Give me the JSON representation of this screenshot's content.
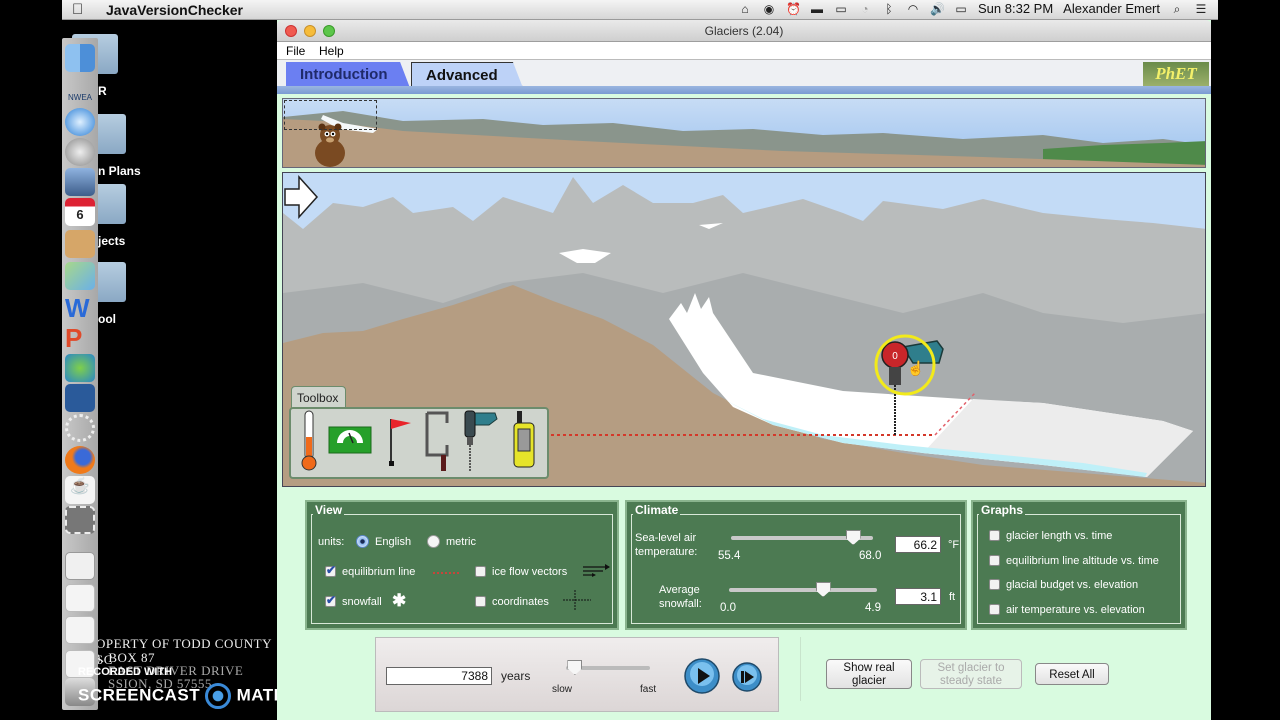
{
  "os": {
    "app_name": "JavaVersionChecker",
    "clock": "Sun 8:32 PM",
    "user": "Alexander Emert",
    "tray_icons": [
      "radio-tower-icon",
      "sync-icon",
      "alarm-clock-icon",
      "monitor-icon",
      "airplay-icon",
      "time-machine-icon",
      "bluetooth-icon",
      "wifi-icon",
      "volume-icon",
      "battery-icon"
    ]
  },
  "desktop": {
    "labels": [
      "R",
      "n Plans",
      "jects",
      "ool"
    ],
    "watermark_lines": [
      "OPERTY OF TODD COUNTY SC",
      "). BOX 87",
      "EAST DRIVER DRIVE",
      "SSION, SD 57555"
    ],
    "recorder": {
      "line1": "RECORDED WITH",
      "line2": "SCREENCAST",
      "line3": "MATIC"
    },
    "dock_items": [
      "finder",
      "nwea",
      "safari",
      "launchpad",
      "preview",
      "calendar",
      "contacts",
      "maps",
      "word",
      "powerpoint",
      "messenger",
      "remote-desktop",
      "loading",
      "firefox",
      "java",
      "screenshot",
      "document",
      "word-doc-1",
      "word-doc-2",
      "word-doc-3",
      "trash"
    ],
    "nwea_label": "NWEA",
    "calendar_day": "6"
  },
  "window": {
    "title": "Glaciers (2.04)",
    "menu": [
      "File",
      "Help"
    ],
    "tabs": [
      {
        "label": "Introduction",
        "active": false
      },
      {
        "label": "Advanced",
        "active": true
      }
    ],
    "logo_text": "PhET"
  },
  "scene": {
    "toolbox_label": "Toolbox",
    "tools": [
      "thermometer",
      "glacial-budget-meter",
      "flag",
      "ice-thickness-tool",
      "ice-core-drill",
      "gps-receiver"
    ],
    "drill_counter": "0"
  },
  "view_panel": {
    "title": "View",
    "units_label": "units:",
    "units": [
      {
        "label": "English",
        "selected": true
      },
      {
        "label": "metric",
        "selected": false
      }
    ],
    "checkboxes": [
      {
        "label": "equilibrium line",
        "checked": true
      },
      {
        "label": "ice flow vectors",
        "checked": false
      },
      {
        "label": "snowfall",
        "checked": true
      },
      {
        "label": "coordinates",
        "checked": false
      }
    ]
  },
  "climate_panel": {
    "title": "Climate",
    "temperature": {
      "label_line1": "Sea-level air",
      "label_line2": "temperature:",
      "min": "55.4",
      "max": "68.0",
      "value": "66.2",
      "unit": "°F"
    },
    "snowfall": {
      "label_line1": "Average",
      "label_line2": "snowfall:",
      "min": "0.0",
      "max": "4.9",
      "value": "3.1",
      "unit": "ft"
    }
  },
  "graphs_panel": {
    "title": "Graphs",
    "items": [
      {
        "label": "glacier length vs. time",
        "checked": false
      },
      {
        "label": "equilibrium line altitude vs. time",
        "checked": false
      },
      {
        "label": "glacial budget vs. elevation",
        "checked": false
      },
      {
        "label": "air temperature vs. elevation",
        "checked": false
      }
    ]
  },
  "clock_control": {
    "years_value": "7388",
    "years_label": "years",
    "speed_slow": "slow",
    "speed_fast": "fast",
    "speed_fraction": 0.1
  },
  "buttons": {
    "show_real_line1": "Show real",
    "show_real_line2": "glacier",
    "steady_line1": "Set glacier to",
    "steady_line2": "steady state",
    "reset": "Reset All"
  }
}
